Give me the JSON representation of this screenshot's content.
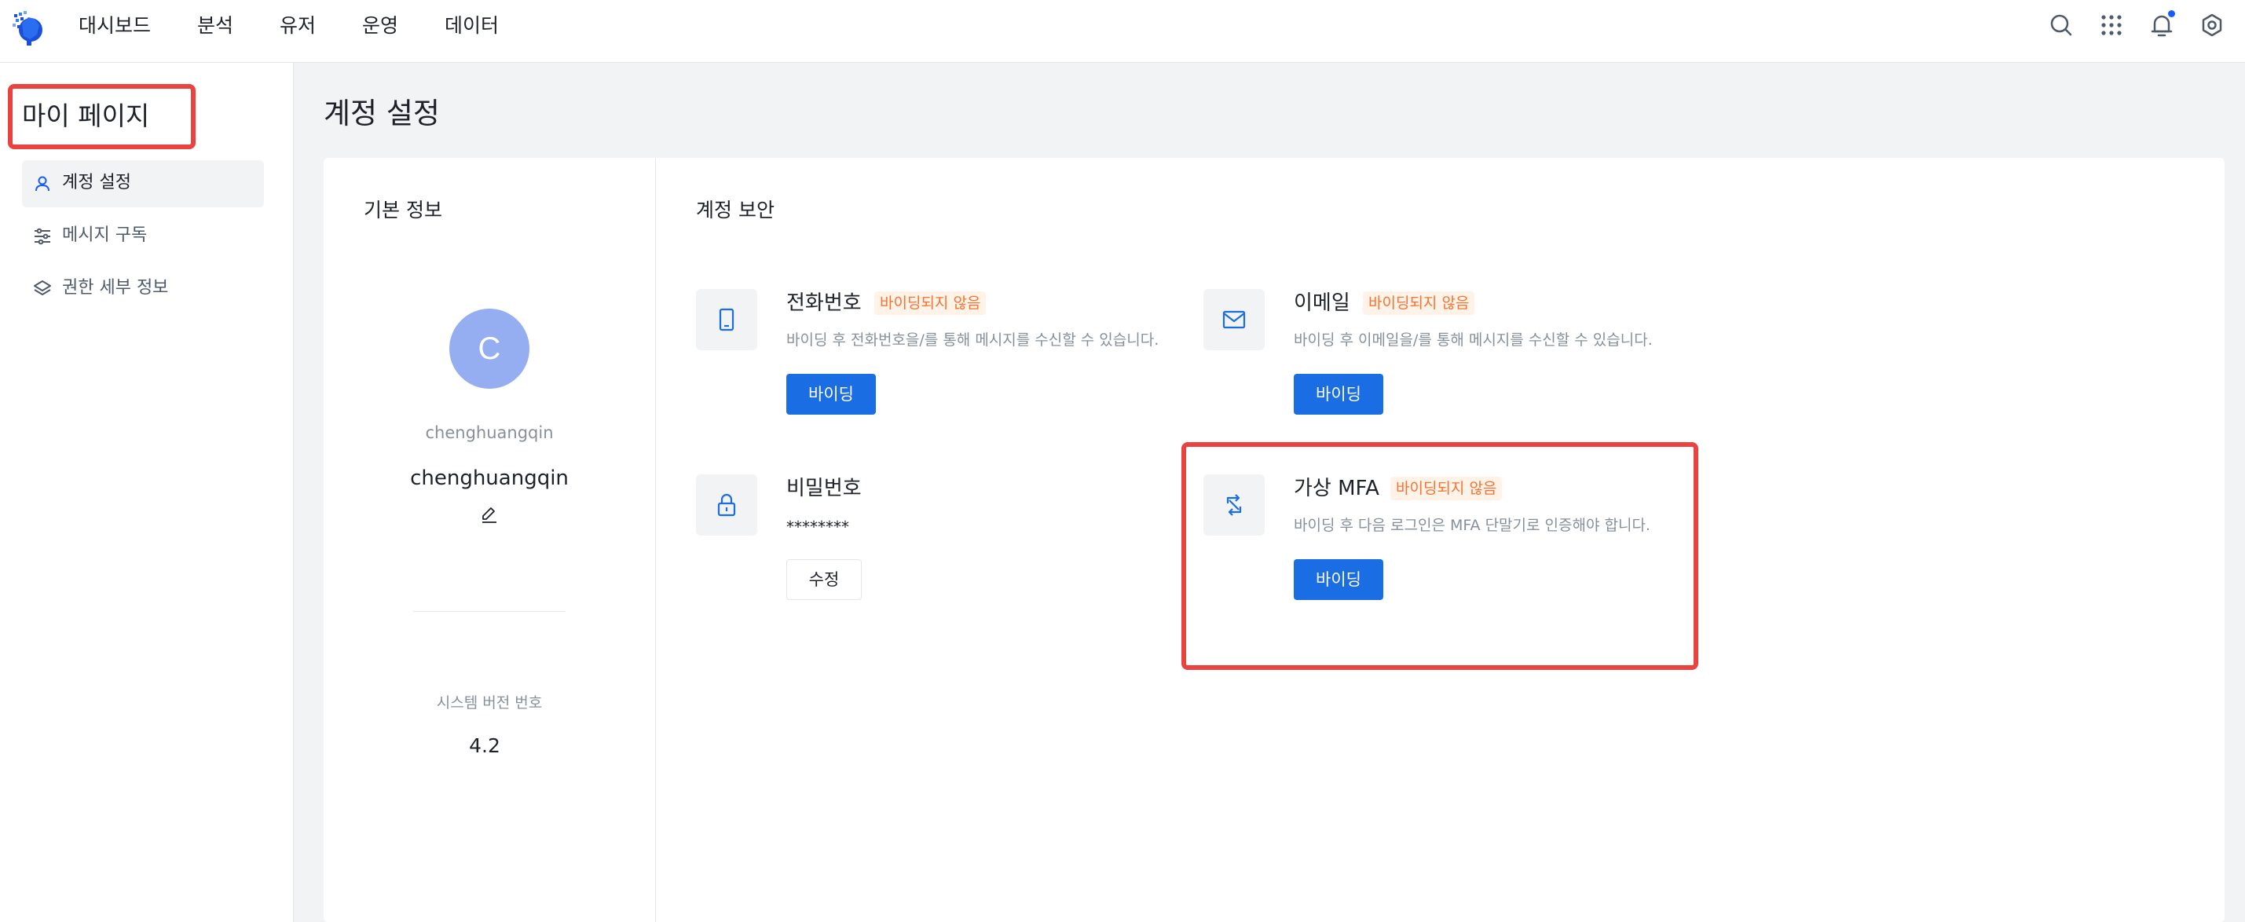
{
  "header": {
    "nav": [
      "대시보드",
      "분석",
      "유저",
      "운영",
      "데이터"
    ],
    "icons": [
      "search-icon",
      "apps-grid-icon",
      "bell-icon",
      "settings-icon"
    ],
    "accent": "#1b6de3"
  },
  "sidebar": {
    "title": "마이 페이지",
    "items": [
      {
        "label": "계정 설정",
        "icon": "user-icon",
        "active": true
      },
      {
        "label": "메시지 구독",
        "icon": "sliders-icon",
        "active": false
      },
      {
        "label": "권한 세부 정보",
        "icon": "layers-icon",
        "active": false
      }
    ]
  },
  "main": {
    "title": "계정 설정",
    "basic_info": {
      "title": "기본 정보",
      "avatar_letter": "C",
      "username_small": "chenghuangqin",
      "username": "chenghuangqin",
      "version_label": "시스템 버전 번호",
      "version": "4.2"
    },
    "security": {
      "title": "계정 보안",
      "phone": {
        "title": "전화번호",
        "badge": "바이딩되지 않음",
        "desc": "바이딩 후 전화번호을/를 통해 메시지를 수신할 수 있습니다.",
        "button": "바이딩"
      },
      "email": {
        "title": "이메일",
        "badge": "바이딩되지 않음",
        "desc": "바이딩 후 이메일을/를 통해 메시지를 수신할 수 있습니다.",
        "button": "바이딩"
      },
      "password": {
        "title": "비밀번호",
        "value": "********",
        "button": "수정"
      },
      "mfa": {
        "title": "가상 MFA",
        "badge": "바이딩되지 않음",
        "desc": "바이딩 후 다음 로그인은 MFA 단말기로 인증해야 합니다.",
        "button": "바이딩"
      }
    }
  },
  "colors": {
    "highlight": "#e9423f",
    "badge_text": "#f77234",
    "avatar": "#94aef1"
  }
}
